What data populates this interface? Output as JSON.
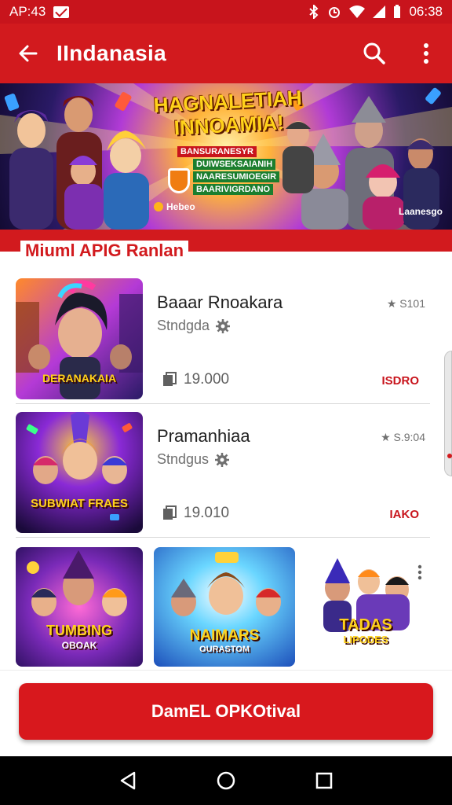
{
  "status_bar": {
    "time_left": "AP:43",
    "time_right": "06:38",
    "icons": [
      "mail-icon",
      "bluetooth-icon",
      "alarm-icon",
      "wifi-icon",
      "signal-icon",
      "battery-icon"
    ]
  },
  "app_bar": {
    "title": "IIndanasia",
    "icons": [
      "back-arrow-icon",
      "search-icon",
      "more-vert-icon"
    ]
  },
  "banner": {
    "title_line1": "HAGNALETIAH",
    "title_line2": "INNOAMIA!",
    "sub_lines": [
      "BANSURANESYR",
      "DUIWSEKSAIANIH",
      "NAARESUMIOEGIR",
      "BAARIVIGRDANO"
    ],
    "left_label": "Hebeo",
    "right_label": "Laanesgo"
  },
  "section": {
    "heading": "Miuml APIG Ranlan"
  },
  "list": [
    {
      "title": "Baaar Rnoakara",
      "subtitle": "Stndgda",
      "meta": "★ S101",
      "count": "19.000",
      "action": "ISDRO",
      "thumb_label": "DERANAKAIA"
    },
    {
      "title": "Pramanhiaa",
      "subtitle": "Stndgus",
      "meta": "★ S.9:04",
      "count": "19.010",
      "action": "IAKO",
      "thumb_label": "SUBWIAT FRAES"
    }
  ],
  "grid": [
    {
      "label": "TUMBING",
      "sublabel": "OBOAK"
    },
    {
      "label": "NAIMARS",
      "sublabel": "OURASTOM"
    },
    {
      "label": "TADAS",
      "sublabel": "LIPODES"
    }
  ],
  "cta": {
    "label": "DamEL OPKOtival"
  },
  "nav": {
    "icons": [
      "back-triangle-icon",
      "home-circle-icon",
      "recents-square-icon"
    ]
  },
  "colors": {
    "brand_red": "#d21a1e",
    "status_red": "#c8141c",
    "accent_gold": "#ffd21a"
  }
}
